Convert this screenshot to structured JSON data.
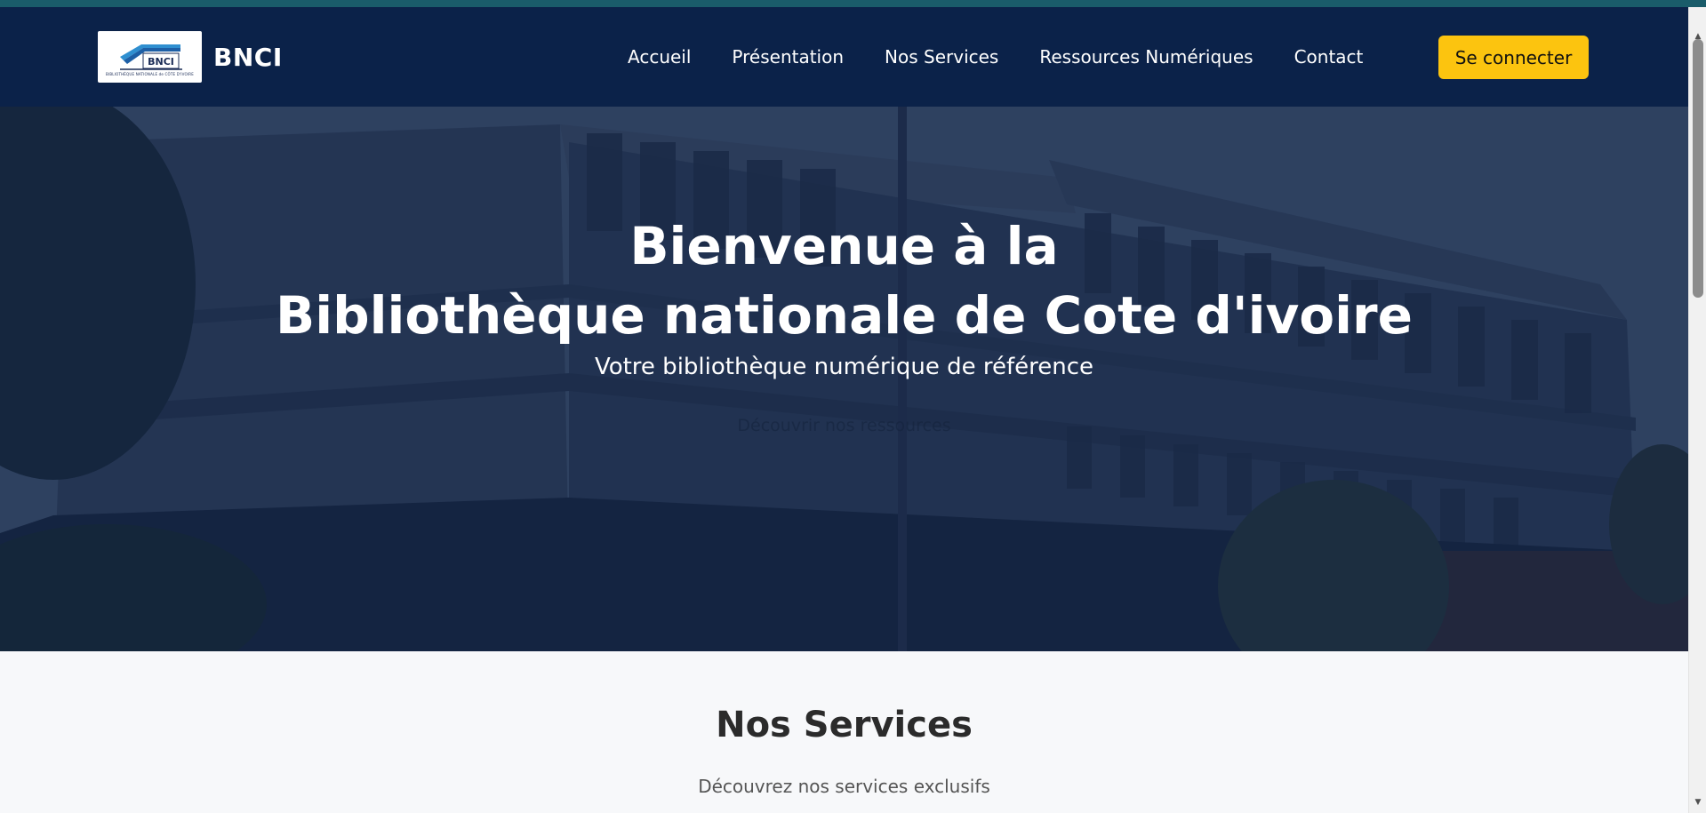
{
  "navbar": {
    "brand_name": "BNCI",
    "logo_text": "BNCI",
    "logo_caption": "BIBLIOTHÈQUE NATIONALE de CÔTE D'IVOIRE",
    "links": [
      {
        "label": "Accueil"
      },
      {
        "label": "Présentation"
      },
      {
        "label": "Nos Services"
      },
      {
        "label": "Ressources Numériques"
      },
      {
        "label": "Contact"
      }
    ],
    "login_label": "Se connecter"
  },
  "hero": {
    "title_line1": "Bienvenue à la",
    "title_line2": "Bibliothèque nationale de Cote d'ivoire",
    "subtitle": "Votre bibliothèque numérique de référence",
    "ghost_text": "Découvrir nos ressources"
  },
  "services": {
    "title": "Nos Services",
    "subtitle": "Découvrez nos services exclusifs"
  },
  "colors": {
    "navbar_bg": "#0b2249",
    "accent": "#fcc40f",
    "top_strip": "#1a5c6a"
  },
  "icons": {
    "scroll_up": "scroll-up-arrow-icon",
    "scroll_down": "scroll-down-arrow-icon"
  }
}
